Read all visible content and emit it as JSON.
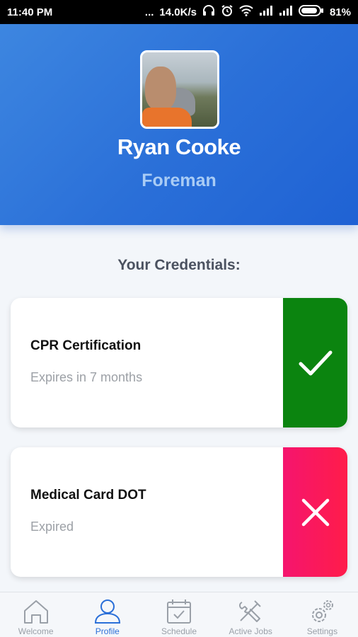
{
  "status_bar": {
    "time": "11:40 PM",
    "dots": "...",
    "speed": "14.0K/s",
    "battery": "81%"
  },
  "profile": {
    "name": "Ryan Cooke",
    "role": "Foreman"
  },
  "credentials": {
    "title": "Your Credentials:",
    "items": [
      {
        "name": "CPR Certification",
        "status": "Expires in 7 months",
        "state": "valid",
        "color": "#0b840f",
        "icon": "check-icon"
      },
      {
        "name": "Medical Card DOT",
        "status": "Expired",
        "state": "expired",
        "color": "#f5156e",
        "icon": "close-icon"
      }
    ]
  },
  "tabs": [
    {
      "label": "Welcome",
      "icon": "home-icon"
    },
    {
      "label": "Profile",
      "icon": "user-icon",
      "active": true
    },
    {
      "label": "Schedule",
      "icon": "calendar-icon"
    },
    {
      "label": "Active Jobs",
      "icon": "tools-icon"
    },
    {
      "label": "Settings",
      "icon": "gear-icon"
    }
  ],
  "colors": {
    "accent": "#2a6fd8",
    "header_light": "#3d86e0",
    "role_text": "#a9ccf5"
  }
}
